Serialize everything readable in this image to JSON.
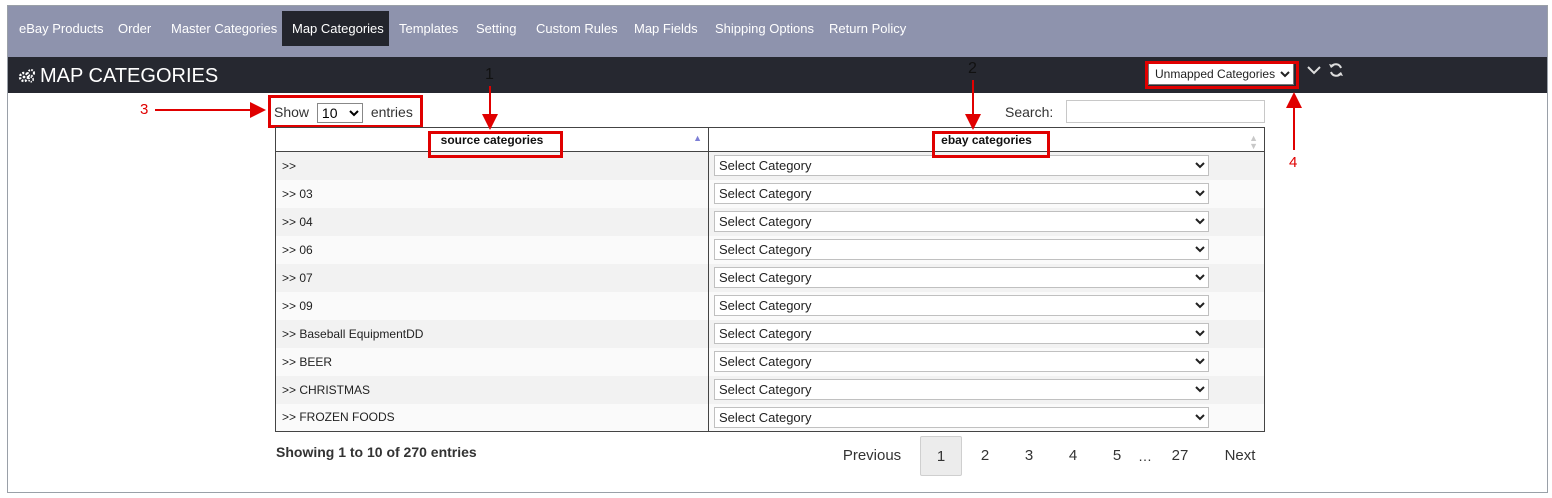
{
  "nav": {
    "items": [
      {
        "label": "eBay Products"
      },
      {
        "label": "Order"
      },
      {
        "label": "Master Categories"
      },
      {
        "label": "Map Categories",
        "active": true
      },
      {
        "label": "Templates"
      },
      {
        "label": "Setting"
      },
      {
        "label": "Custom Rules"
      },
      {
        "label": "Map Fields"
      },
      {
        "label": "Shipping Options"
      },
      {
        "label": "Return Policy"
      }
    ]
  },
  "header": {
    "title": "MAP CATEGORIES",
    "title_icon": "gears-icon",
    "filter_selected": "Unmapped Categories",
    "collapse_icon": "chevron-down-icon",
    "refresh_icon": "refresh-icon"
  },
  "table_controls": {
    "show_label": "Show",
    "page_length": "10",
    "entries_label": "entries",
    "search_label": "Search:",
    "search_value": ""
  },
  "table": {
    "columns": [
      "source categories",
      "ebay categories"
    ],
    "select_placeholder": "Select Category",
    "rows": [
      ">>",
      ">> 03",
      ">> 04",
      ">> 06",
      ">> 07",
      ">> 09",
      ">> Baseball EquipmentDD",
      ">> BEER",
      ">> CHRISTMAS",
      ">> FROZEN FOODS"
    ]
  },
  "footer": {
    "info": "Showing 1 to 10 of 270 entries",
    "previous": "Previous",
    "pages": [
      "1",
      "2",
      "3",
      "4",
      "5"
    ],
    "ellipsis": "…",
    "last_page": "27",
    "next": "Next",
    "current_page": "1"
  },
  "annotations": {
    "labels": [
      "1",
      "2",
      "3",
      "4"
    ]
  },
  "colors": {
    "nav_bg": "#8e93ad",
    "active_tab": "#23252d",
    "titlebar": "#262830",
    "highlight": "#e00000"
  }
}
